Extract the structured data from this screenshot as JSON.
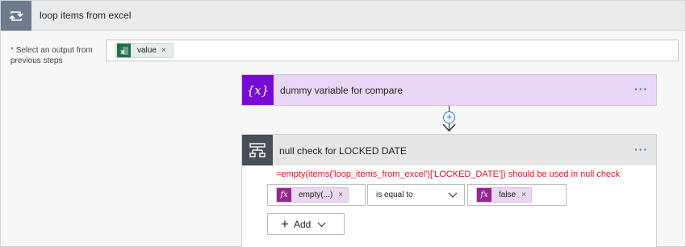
{
  "loop": {
    "title": "loop items from excel",
    "icon": "loop-icon",
    "output_label_required": "*",
    "output_label": "Select an output from previous steps",
    "token": {
      "label": "value",
      "icon": "excel-icon",
      "remove": "×"
    }
  },
  "variable_action": {
    "title": "dummy variable for compare",
    "icon": "variable-icon",
    "icon_glyph": "{x}",
    "menu": "···",
    "color": "#770bd6"
  },
  "connector": {
    "add_glyph": "+"
  },
  "condition": {
    "title": "null check for LOCKED DATE",
    "icon": "condition-icon",
    "menu": "···",
    "note": "=empty(items('loop_items_from_excel')['LOCKED_DATE']) should be used in null check",
    "left_operand": {
      "fx": "fx",
      "label": "empty(...)",
      "remove": "×"
    },
    "operator": "is equal to",
    "right_operand": {
      "fx": "fx",
      "label": "false",
      "remove": "×"
    },
    "add_button": {
      "plus": "+",
      "label": "Add"
    }
  },
  "colors": {
    "accent": "#2b78d4",
    "error": "#e81123",
    "expression": "#93278f",
    "excel": "#1d7044"
  }
}
